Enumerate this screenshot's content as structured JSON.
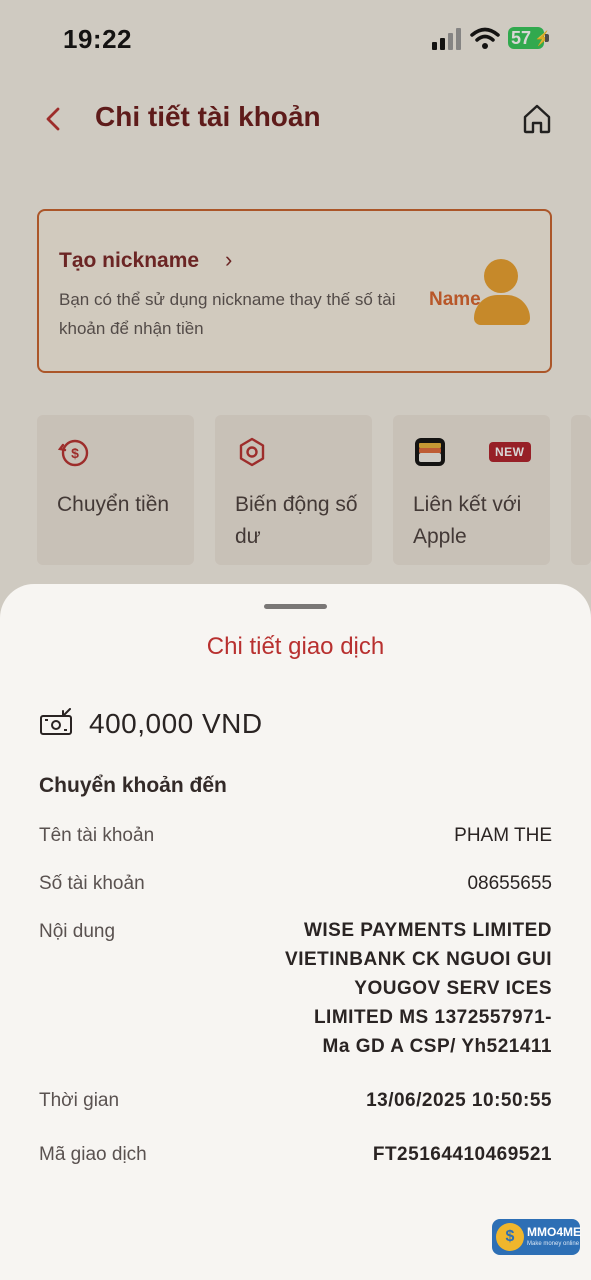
{
  "status_bar": {
    "time": "19:22",
    "battery": "57"
  },
  "header": {
    "title": "Chi tiết tài khoản"
  },
  "nickname_card": {
    "title": "Tạo nickname",
    "description": "Bạn có thể sử dụng nickname thay thế số tài khoản để nhận tiền",
    "illustration_text": "Name"
  },
  "actions": [
    {
      "label": "Chuyển tiền"
    },
    {
      "label": "Biến động số dư"
    },
    {
      "label": "Liên kết với Apple",
      "badge": "NEW"
    }
  ],
  "sheet": {
    "title": "Chi tiết giao dịch",
    "amount": "400,000 VND",
    "type": "Chuyển khoản đến",
    "rows": [
      {
        "label": "Tên tài khoản",
        "value": "PHAM THE"
      },
      {
        "label": "Số tài khoản",
        "value": "08655655"
      },
      {
        "label": "Nội dung",
        "value": "WISE PAYMENTS LIMITED VIETINBANK CK NGUOI GUI YOUGOV SERV ICES LIMITED MS 1372557971- Ma GD A CSP/ Yh521411"
      },
      {
        "label": "Thời gian",
        "value": "13/06/2025 10:50:55"
      },
      {
        "label": "Mã giao dịch",
        "value": "FT25164410469521"
      }
    ]
  },
  "watermark": {
    "text": "MMO4ME",
    "subtext": "Make money online"
  }
}
